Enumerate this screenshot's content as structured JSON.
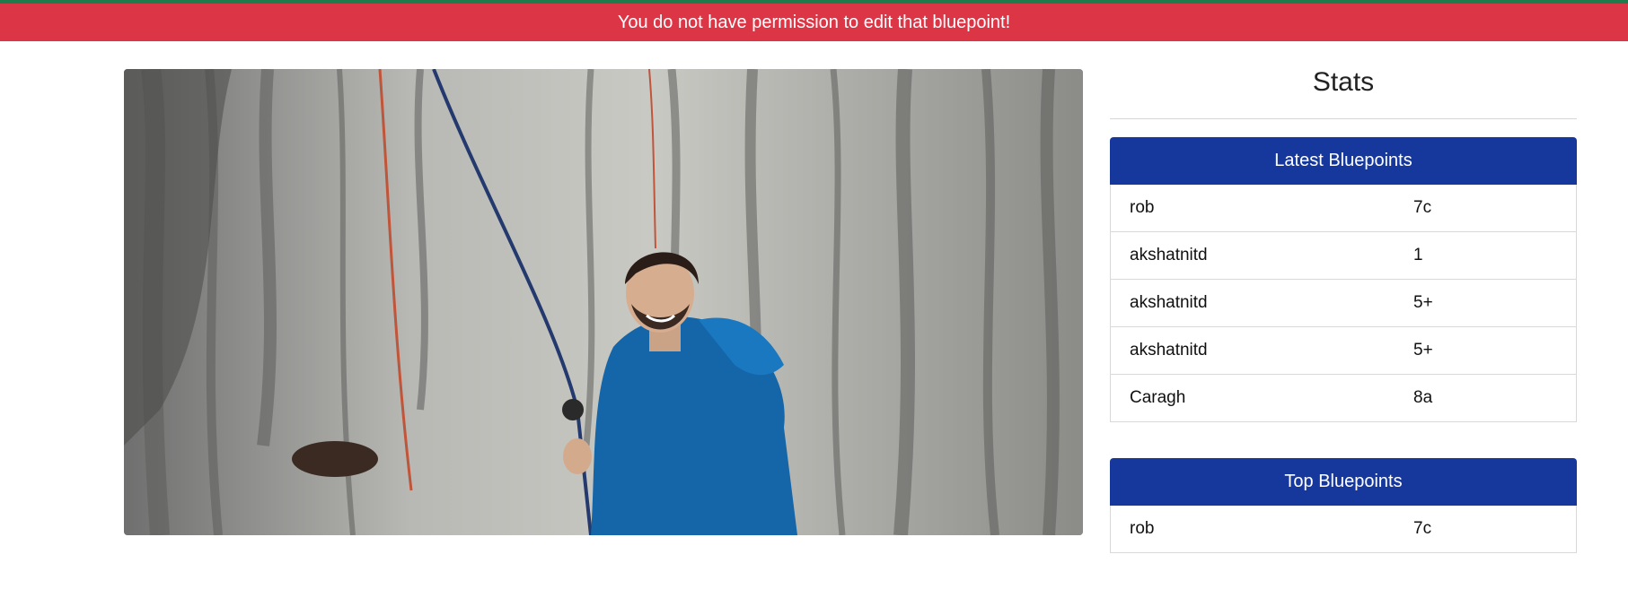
{
  "alert": {
    "message": "You do not have permission to edit that bluepoint!"
  },
  "hero": {
    "image_alt": "climber in blue jacket smiling at the base of a limestone wall"
  },
  "sidebar": {
    "stats_title": "Stats",
    "latest": {
      "header": "Latest Bluepoints",
      "rows": [
        {
          "name": "rob",
          "grade": "7c"
        },
        {
          "name": "akshatnitd",
          "grade": "1"
        },
        {
          "name": "akshatnitd",
          "grade": "5+"
        },
        {
          "name": "akshatnitd",
          "grade": "5+"
        },
        {
          "name": "Caragh",
          "grade": "8a"
        }
      ]
    },
    "top": {
      "header": "Top Bluepoints",
      "rows": [
        {
          "name": "rob",
          "grade": "7c"
        }
      ]
    }
  },
  "colors": {
    "alert_bg": "#dc3545",
    "card_header_bg": "#16389d",
    "top_strip": "#1f7a4c"
  }
}
